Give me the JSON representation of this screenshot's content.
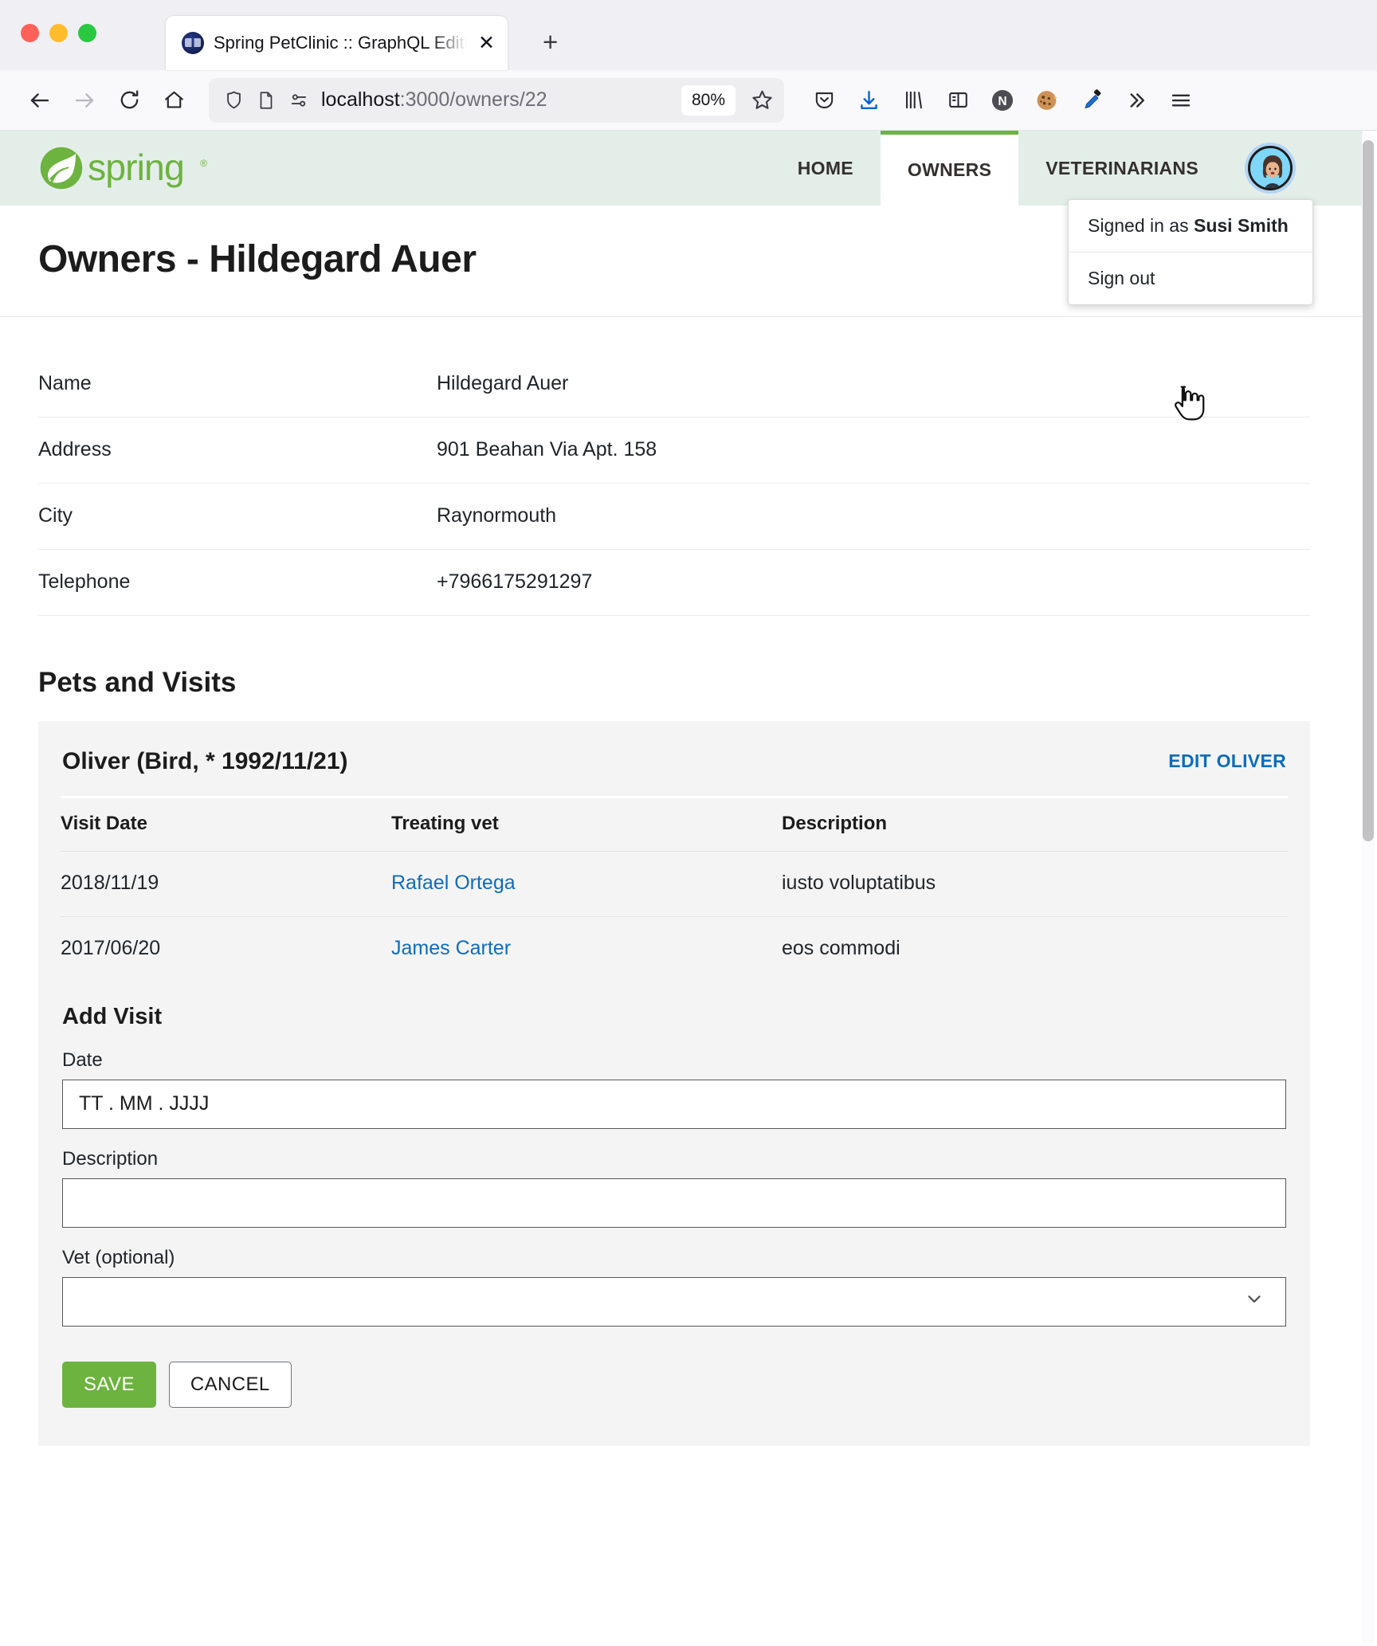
{
  "browser": {
    "tab": {
      "title": "Spring PetClinic :: GraphQL Editi",
      "close_label": "✕"
    },
    "new_tab_label": "+",
    "url_display": "localhost",
    "url_rest": ":3000/owners/22",
    "zoom_level": "80%",
    "nav_icons": [
      "back-arrow-icon",
      "forward-arrow-icon",
      "reload-icon",
      "home-icon"
    ],
    "urlbar_icons": [
      "shield-icon",
      "page-icon",
      "permissions-icon"
    ],
    "toolbar_icons": [
      "pocket-icon",
      "download-icon",
      "library-icon",
      "sidebar-icon",
      "notion-extension-icon",
      "cookie-extension-icon",
      "eyedropper-extension-icon",
      "overflow-chevrons-icon",
      "hamburger-menu-icon"
    ]
  },
  "site": {
    "logo_text": "spring",
    "nav": [
      {
        "label": "HOME",
        "active": false
      },
      {
        "label": "OWNERS",
        "active": true
      },
      {
        "label": "VETERINARIANS",
        "active": false
      }
    ],
    "avatar_name": "user-avatar",
    "dropdown": {
      "signed_in_prefix": "Signed in as ",
      "signed_in_user": "Susi Smith",
      "sign_out": "Sign out"
    }
  },
  "page": {
    "title": "Owners - Hildegard Auer",
    "owner": {
      "rows": [
        {
          "label": "Name",
          "value": "Hildegard Auer"
        },
        {
          "label": "Address",
          "value": "901 Beahan Via Apt. 158"
        },
        {
          "label": "City",
          "value": "Raynormouth"
        },
        {
          "label": "Telephone",
          "value": "+7966175291297"
        }
      ]
    },
    "pets_section_title": "Pets and Visits",
    "pet": {
      "heading": "Oliver (Bird, * 1992/11/21)",
      "edit_label": "EDIT OLIVER",
      "visits_headers": [
        "Visit Date",
        "Treating vet",
        "Description"
      ],
      "visits": [
        {
          "date": "2018/11/19",
          "vet": "Rafael Ortega",
          "description": "iusto voluptatibus"
        },
        {
          "date": "2017/06/20",
          "vet": "James Carter",
          "description": "eos commodi"
        }
      ]
    },
    "add_visit": {
      "heading": "Add Visit",
      "date_label": "Date",
      "date_placeholder": "TT . MM . JJJJ",
      "description_label": "Description",
      "description_value": "",
      "vet_label": "Vet (optional)",
      "vet_value": "",
      "save_label": "SAVE",
      "cancel_label": "CANCEL"
    }
  },
  "colors": {
    "spring_green": "#6db33f",
    "link_blue": "#0f6cbd",
    "header_bg": "#e4eee9",
    "card_bg": "#f4f4f4"
  }
}
